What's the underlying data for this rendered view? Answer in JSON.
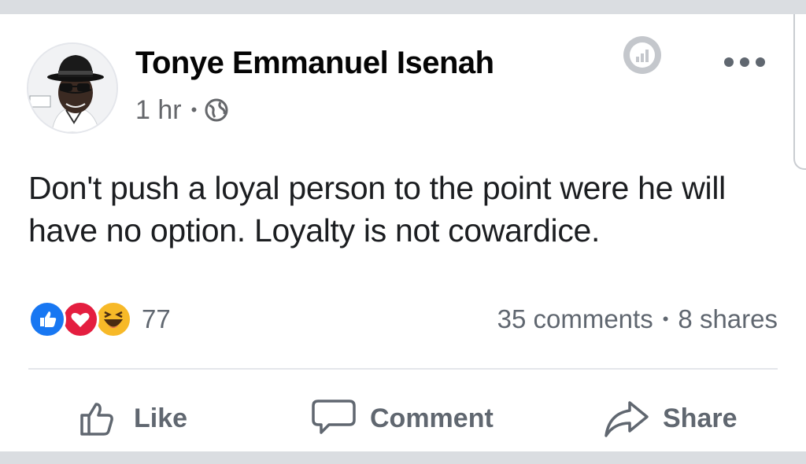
{
  "post": {
    "author": "Tonye Emmanuel Isenah",
    "time": "1 hr",
    "meta_separator": "•",
    "privacy_icon": "globe-icon",
    "text": "Don't push a loyal person to the point were he will have no option. Loyalty is not cowardice."
  },
  "header_icons": {
    "insights": "bar-chart-icon",
    "more": "more-options-icon"
  },
  "reactions": {
    "types": [
      "like",
      "love",
      "haha"
    ],
    "count": "77"
  },
  "stats": {
    "comments": "35 comments",
    "separator": "•",
    "shares": "8 shares"
  },
  "actions": {
    "like": "Like",
    "comment": "Comment",
    "share": "Share"
  },
  "colors": {
    "like_blue": "#1877f2",
    "love_red": "#e41e3f",
    "haha_yellow": "#f7b928",
    "secondary_text": "#606770",
    "primary_text": "#050505"
  }
}
